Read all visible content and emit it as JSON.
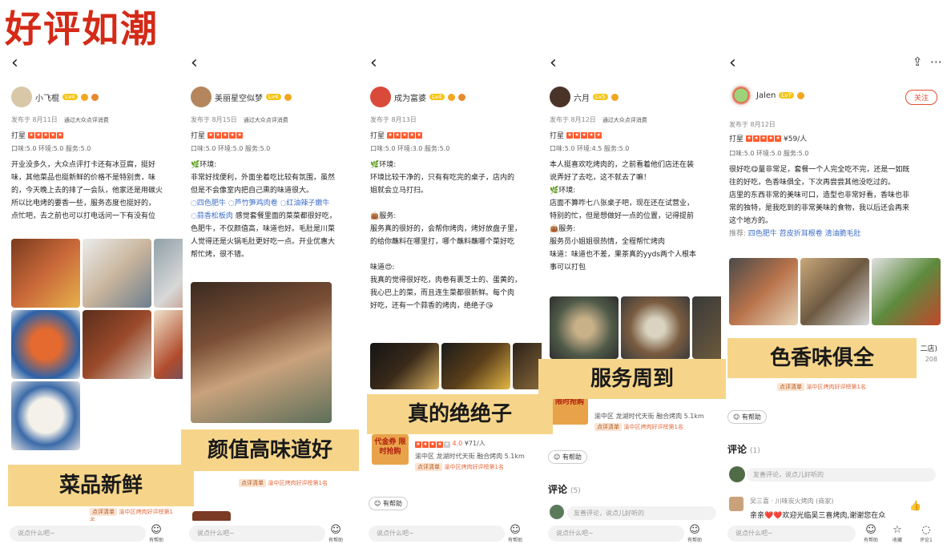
{
  "title": "好评如潮",
  "banners": [
    "菜品新鲜",
    "颜值高味道好",
    "真的绝绝子",
    "服务周到",
    "色香味俱全"
  ],
  "common": {
    "pub_source": "通过大众点评消费",
    "rating_label": "打星",
    "say_placeholder": "说点什么吧~",
    "help_label": "有帮助",
    "helpful_button": "有帮助",
    "comment_placeholder": "友善评论，说点儿好听的",
    "dianping_tag": "点评清单",
    "rank_text": "渝中区烤肉好评榜第1名"
  },
  "p1": {
    "name": "小飞棍",
    "level": "Lv4",
    "date": "发布于 8月11日",
    "scores": "口味:5.0  环境:5.0  服务:5.0",
    "lines": [
      "开业没多久，大众点评打卡还有冰豆腐，挺好",
      "味，其他菜品也挺新鲜的价格不是特别贵，味",
      "的，今天晚上去的排了一会队，他家还是用碳火",
      "所以比电烤的要香一些，服务态度也挺好的，",
      "点忙吧，去之前也可以打电话问一下有没有位"
    ]
  },
  "p2": {
    "name": "美丽星空似梦",
    "level": "Lv4",
    "date": "发布于 8月15日",
    "scores": "口味:5.0  环境:5.0  服务:5.0",
    "env": "🌿环境:",
    "lines": [
      "非常好找便利，外面坐着吃比较有氛围，虽然",
      "但是不会像室内把自己熏的味道很大。"
    ],
    "dishes": [
      "◌四色肥牛",
      "◌芦竹笋鸡肉卷",
      "◌红油辣子嫩牛",
      "◌蒜香松板肉"
    ],
    "dish_tail": "感觉套餐里面的菜菜都很好吃，",
    "lines2": [
      "色肥牛，不仅颜值高，味道也好。毛肚是川菜",
      "人觉得还是火锅毛肚更好吃一点。开业优惠大",
      "帮忙烤，很不错。"
    ]
  },
  "p3": {
    "name": "成为富婆",
    "level": "Lv4",
    "date": "发布于 8月13日",
    "scores": "口味:5.0  环境:3.0  服务:5.0",
    "lines": [
      "🌿环境:",
      "环境比较干净的，只有有吃完的桌子，店内的",
      "姐就会立马打扫。",
      "",
      "👜服务:",
      "服务真的很好的，会帮你烤肉，烤好放盘子里，",
      "的给你蘸料在哪里打，哪个蘸料蘸哪个菜好吃",
      "",
      "味道😍:",
      "我真的觉得很好吃，肉卷有裹芝士的、蛋黄的，",
      "我心巴上的菜，而且连生菜都很新鲜。每个肉",
      "好吃，还有一个蒜香的烤肉，绝绝子😘"
    ],
    "shop_rating": "4.0",
    "shop_price": "¥71/人",
    "shop_area": "渝中区 龙湖时代天街 融合烤肉 5.1km",
    "promo": "代金券 限时抢购",
    "comment_title": "评论",
    "comment_count": "(5)"
  },
  "p4": {
    "name": "六月",
    "level": "Lv5",
    "date": "发布于 8月12日",
    "scores": "口味:5.0  环境:4.5  服务:5.0",
    "lines": [
      "本人挺喜欢吃烤肉的，之前看着他们店还在装",
      "说弄好了去吃，这不就去了嘛！",
      "🌿环境:",
      "店面不算咋七八张桌子吧，现在还在试营业，",
      "特别的忙，但是想做好一点的位置，记得提前",
      "👜服务:",
      "服务员小姐姐很热情，全程帮忙烤肉",
      "味道：味道也不差，果茶真的yyds两个人根本",
      "事可以打包"
    ],
    "shop_rating": "4.0",
    "shop_price": "¥71/人",
    "shop_area": "渝中区 龙湖时代天街 融合烤肉 5.1km",
    "promo": "限时抢购",
    "comment_title": "评论",
    "comment_count": "(5)"
  },
  "p5": {
    "name": "Jalen",
    "level": "Lv7",
    "follow": "关注",
    "date": "发布于 8月12日",
    "price": "¥59/人",
    "scores": "口味:5.0  环境:5.0  服务:5.0",
    "lines": [
      "很好吃😋量非常足，套餐一个人完全吃不完，还是一如既",
      "往的好吃，色香味俱全，下次再尝尝其他没吃过的。",
      "店里的东西非常的美味可口，造型也非常好看，香味也非",
      "常的独特，是我吃到的非常美味的食物，我以后还会再来",
      "这个地方的。"
    ],
    "recommend_label": "推荐:",
    "recommend": "四色肥牛 苕皮折耳根卷 清油脆毛肚",
    "shop_suffix": "二店)",
    "shop_extra": "208",
    "comment_title": "评论",
    "comment_count": "(1)",
    "reply_name": "吴三喜 · 川味炭火烤肉 (商家)",
    "reply_text": "亲亲❤️❤️欢迎光临吴三喜烤肉,谢谢您在众",
    "bar_labels": [
      "有帮助",
      "收藏",
      "评论1"
    ]
  },
  "colors": {
    "title": "#d42a17",
    "banner": "#f6d58a",
    "star": "#ff5b2f",
    "link": "#3b6cc9"
  }
}
